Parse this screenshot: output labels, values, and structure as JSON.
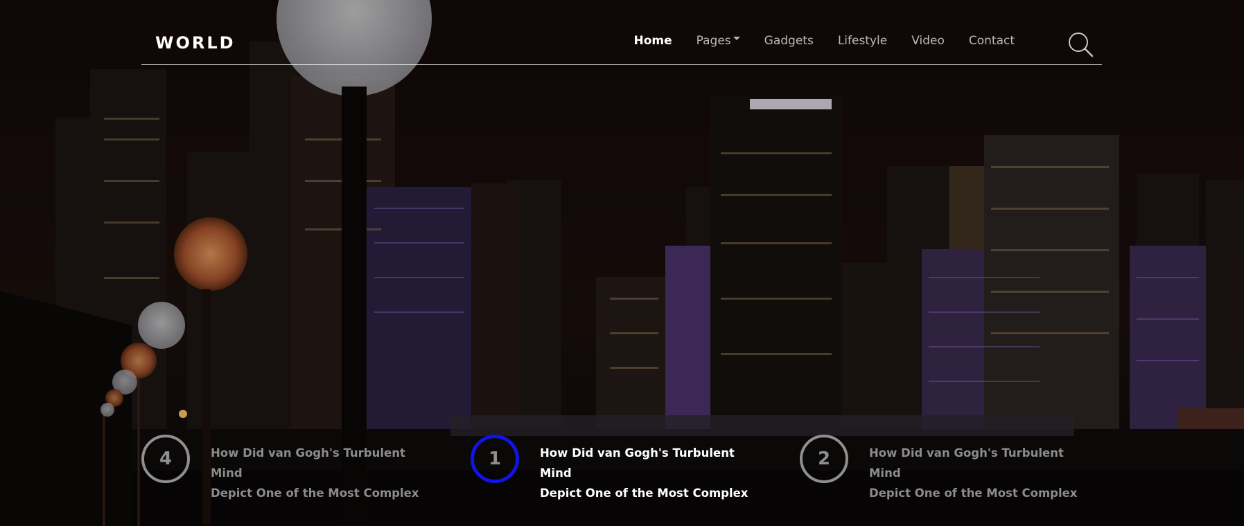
{
  "brand": {
    "logo": "WORLD"
  },
  "nav": {
    "items": [
      {
        "label": "Home",
        "active": true
      },
      {
        "label": "Pages",
        "dropdown": true
      },
      {
        "label": "Gadgets"
      },
      {
        "label": "Lifestyle"
      },
      {
        "label": "Video"
      },
      {
        "label": "Contact"
      }
    ],
    "search_icon": "search-icon"
  },
  "slides": [
    {
      "number": "4",
      "title_line1": "How Did van Gogh's Turbulent Mind",
      "title_line2": "Depict One of the Most Complex",
      "active": false
    },
    {
      "number": "1",
      "title_line1": "How Did van Gogh's Turbulent Mind",
      "title_line2": "Depict One of the Most Complex",
      "active": true
    },
    {
      "number": "2",
      "title_line1": "How Did van Gogh's Turbulent Mind",
      "title_line2": "Depict One of the Most Complex",
      "active": false
    }
  ],
  "colors": {
    "active_indicator": "#1313e6",
    "inactive": "#8f8f8f",
    "text_active": "#ffffff"
  }
}
